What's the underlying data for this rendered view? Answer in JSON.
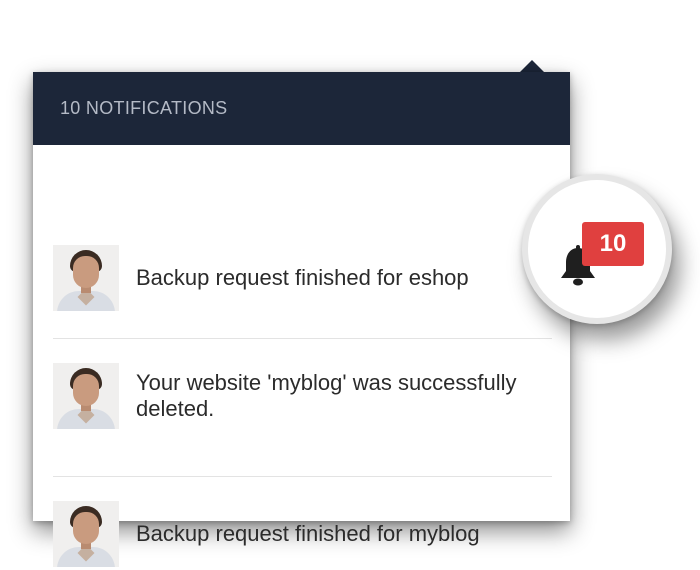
{
  "header": {
    "title": "10 NOTIFICATIONS"
  },
  "notifications": [
    {
      "text": "Backup request finished for eshop",
      "avatar_icon": "user-avatar"
    },
    {
      "text": "Your website 'myblog' was successfully deleted.",
      "avatar_icon": "user-avatar"
    },
    {
      "text": "Backup request finished for myblog",
      "avatar_icon": "user-avatar"
    }
  ],
  "bell": {
    "icon": "bell-icon",
    "count": "10"
  },
  "colors": {
    "header_bg": "#1c2639",
    "header_text": "#b4bac6",
    "badge": "#e0403f"
  }
}
